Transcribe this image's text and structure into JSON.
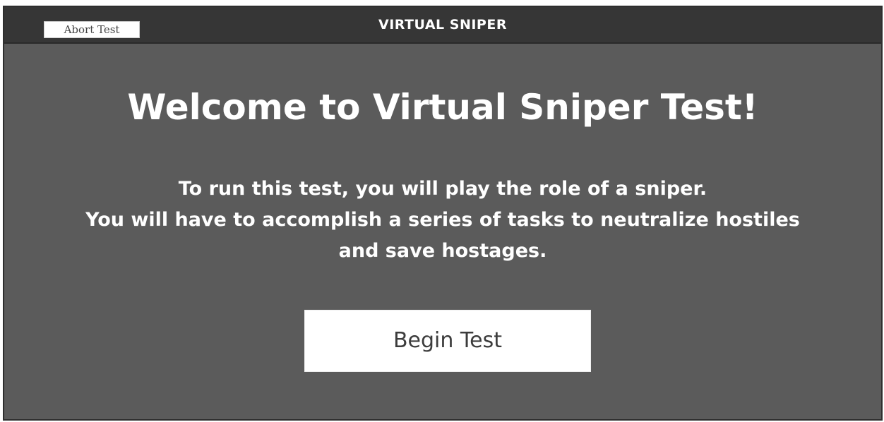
{
  "header": {
    "abort_label": "Abort Test",
    "title": "VIRTUAL SNIPER"
  },
  "main": {
    "heading": "Welcome to Virtual Sniper Test!",
    "intro_lines": [
      "To run this test, you will play the role of a sniper.",
      "You will have to accomplish a series of tasks to neutralize hostiles",
      "and save hostages."
    ],
    "begin_label": "Begin Test"
  },
  "colors": {
    "background": "#5b5b5b",
    "header_background": "#363636",
    "text": "#ffffff",
    "button_background": "#ffffff",
    "button_text": "#3c3c3c"
  }
}
